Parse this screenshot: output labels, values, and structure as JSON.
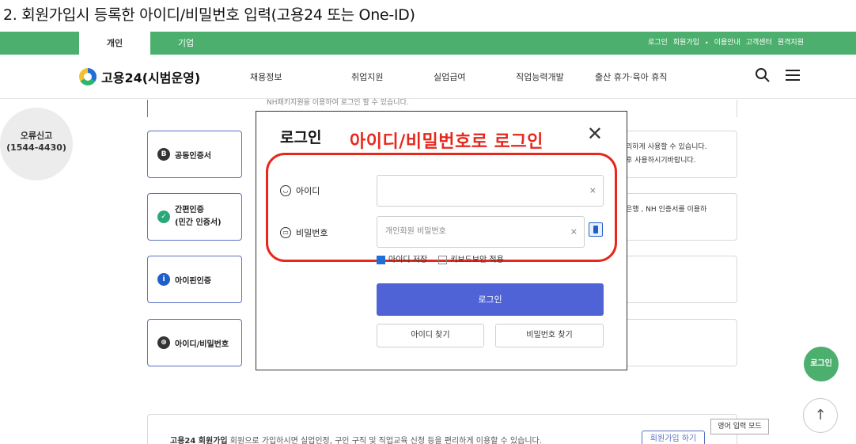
{
  "caption": "2. 회원가입시 등록한 아이디/비밀번호 입력(고용24 또는 One-ID)",
  "topbar": {
    "tab_personal": "개인",
    "tab_company": "기업",
    "util": [
      "로그인",
      "회원가입",
      "•",
      "이용안내",
      "고객센터",
      "원격지원"
    ]
  },
  "header": {
    "logo": "고용24(시범운영)",
    "menu": [
      "채용정보",
      "취업지원",
      "실업급여",
      "직업능력개발",
      "출산 휴가·육아 휴직"
    ],
    "icons": [
      "search-icon",
      "menu-icon"
    ]
  },
  "background": {
    "side_badge_line1": "오류신고",
    "side_badge_line2": "(1544-4430)",
    "top_strip_text": "NH패키지원을 이용하여 로그인 할 수 있습니다.",
    "cards": [
      {
        "label": "공동인증서",
        "icon": "cert-icon"
      },
      {
        "label": "간편인증\n(민간 인증서)",
        "icon": "shield-check-icon"
      },
      {
        "label": "아이핀인증",
        "icon": "info-icon"
      },
      {
        "label": "아이디/비밀번호",
        "icon": "lock-icon"
      }
    ],
    "right_box_1_line1": "리하게 사용할 수 있습니다.",
    "right_box_1_line2": "후 사용하시기바랍니다.",
    "right_box_2_line1": "은행 , NH 인증서를 이용하",
    "bottom_text_bold": "고용24 회원가입",
    "bottom_text": "회원으로 가입하시면 실업인정, 구인 구직 및 직업교육 신청 등을 편리하게 이용할 수 있습니다.",
    "bottom_button": "회원가입 하기"
  },
  "modal": {
    "title": "로그인",
    "annotation": "아이디/비밀번호로 로그인",
    "close": "✕",
    "id_label": "아이디",
    "id_value": "",
    "id_clear": "×",
    "pw_label": "비밀번호",
    "pw_placeholder": "개인회원 비밀번호",
    "pw_clear": "×",
    "save_id": "아이디 저장",
    "save_id_checked": true,
    "keyboard_security": "키보드보안 적용",
    "login_button": "로그인",
    "find_id": "아이디 찾기",
    "find_pw": "비밀번호 찾기"
  },
  "floating": {
    "login": "로그인",
    "top": "↑",
    "ime": "영어 입력 모드"
  }
}
